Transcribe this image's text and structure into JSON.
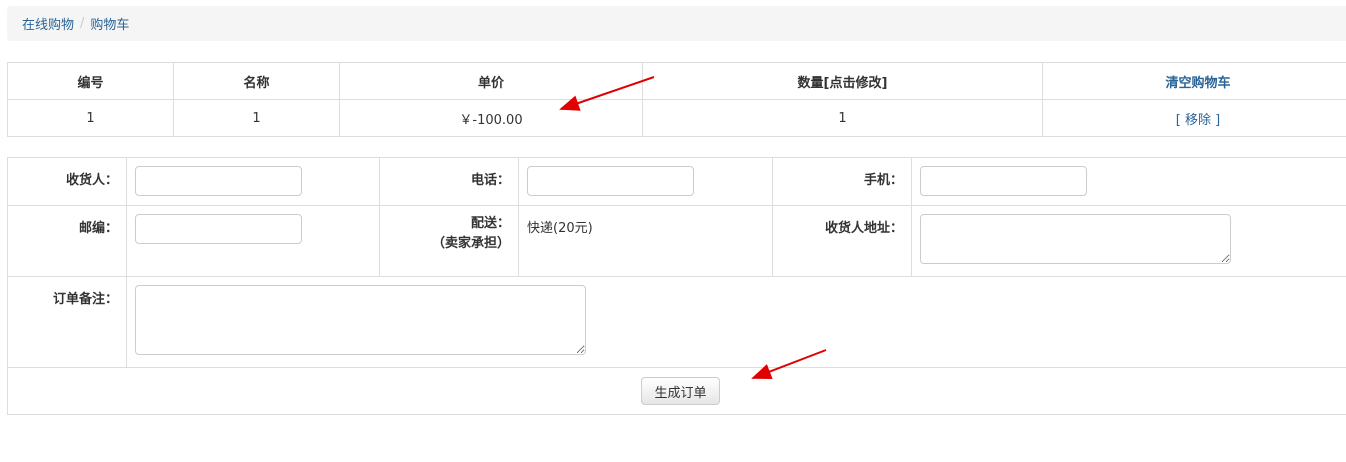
{
  "breadcrumb": {
    "home": "在线购物",
    "current": "购物车",
    "separator": "/"
  },
  "cart": {
    "headers": {
      "id": "编号",
      "name": "名称",
      "price": "单价",
      "qty": "数量[点击修改]",
      "clear": "清空购物车"
    },
    "rows": [
      {
        "id": "1",
        "name": "1",
        "price": "￥-100.00",
        "qty": "1",
        "remove": "[ 移除 ]"
      }
    ]
  },
  "order": {
    "receiver_label": "收货人：",
    "phone_label": "电话：",
    "mobile_label": "手机：",
    "zip_label": "邮编：",
    "delivery_label": "配送：",
    "delivery_sub": "（卖家承担）",
    "delivery_value": "快递(20元)",
    "address_label": "收货人地址：",
    "note_label": "订单备注：",
    "submit": "生成订单"
  },
  "colors": {
    "link": "#2a6496",
    "arrow": "#e00000",
    "border": "#dddddd"
  },
  "annotations": [
    "red-arrow-to-price",
    "red-arrow-to-submit-button"
  ]
}
